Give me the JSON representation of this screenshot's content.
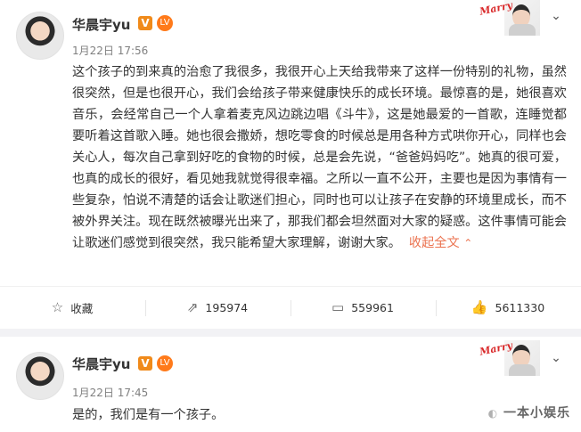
{
  "posts": [
    {
      "username": "华晨宇yu",
      "verified_badge": "V",
      "level_badge": "LV",
      "timestamp": "1月22日 17:56",
      "text": "这个孩子的到来真的治愈了我很多，我很开心上天给我带来了这样一份特别的礼物，虽然很突然，但是也很开心，我们会给孩子带来健康快乐的成长环境。最惊喜的是，她很喜欢音乐，会经常自己一个人拿着麦克风边跳边唱《斗牛》，这是她最爱的一首歌，连睡觉都要听着这首歌入睡。她也很会撒娇，想吃零食的时候总是用各种方式哄你开心，同样也会关心人，每次自己拿到好吃的食物的时候，总是会先说，“爸爸妈妈吃”。她真的很可爱，也真的成长的很好，看见她我就觉得很幸福。之所以一直不公开，主要也是因为事情有一些复杂，怕说不清楚的话会让歌迷们担心，同时也可以让孩子在安静的环境里成长，而不被外界关注。现在既然被曝光出来了，那我们都会坦然面对大家的疑惑。这件事情可能会让歌迷们感觉到很突然，我只能希望大家理解，谢谢大家。",
      "collapse_label": "收起全文",
      "collapse_icon": "^",
      "actions": {
        "favorite_label": "收藏",
        "repost_count": "195974",
        "comment_count": "559961",
        "like_count": "5611330"
      }
    },
    {
      "username": "华晨宇yu",
      "verified_badge": "V",
      "level_badge": "LV",
      "timestamp": "1月22日 17:45",
      "text": "是的，我们是有一个孩子。"
    }
  ],
  "watermark": "一本小娱乐",
  "colors": {
    "accent": "#eb7350",
    "verified": "#f08a1a",
    "separator": "#f2f2f5"
  },
  "icons": {
    "favorite": "star-icon",
    "repost": "share-icon",
    "comment": "comment-icon",
    "like": "thumbs-up-icon",
    "menu": "chevron-down-icon"
  }
}
